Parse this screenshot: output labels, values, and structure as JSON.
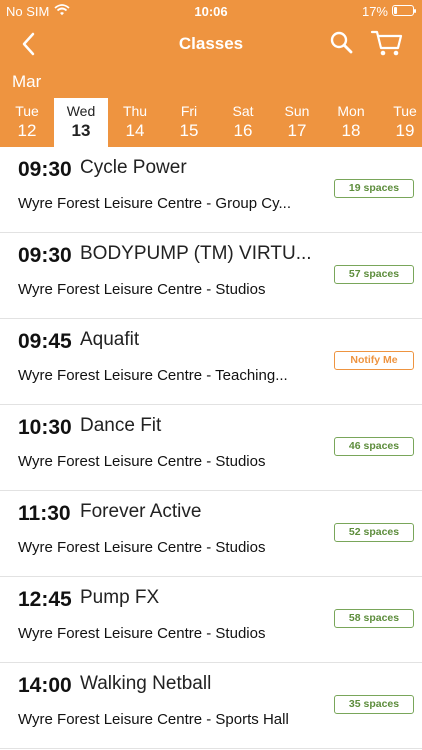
{
  "status_bar": {
    "carrier": "No SIM",
    "time": "10:06",
    "battery_percent": "17%",
    "battery_level": 0.17
  },
  "nav": {
    "title": "Classes",
    "back_icon": "chevron-left-icon",
    "search_icon": "search-icon",
    "cart_icon": "cart-icon"
  },
  "calendar": {
    "month": "Mar",
    "days": [
      {
        "name": "Tue",
        "num": "12",
        "selected": false
      },
      {
        "name": "Wed",
        "num": "13",
        "selected": true
      },
      {
        "name": "Thu",
        "num": "14",
        "selected": false
      },
      {
        "name": "Fri",
        "num": "15",
        "selected": false
      },
      {
        "name": "Sat",
        "num": "16",
        "selected": false
      },
      {
        "name": "Sun",
        "num": "17",
        "selected": false
      },
      {
        "name": "Mon",
        "num": "18",
        "selected": false
      },
      {
        "name": "Tue",
        "num": "19",
        "selected": false
      }
    ]
  },
  "classes": [
    {
      "time": "09:30",
      "name": "Cycle Power",
      "venue": "Wyre Forest Leisure Centre - Group Cy...",
      "badge": "19 spaces",
      "badge_type": "spaces"
    },
    {
      "time": "09:30",
      "name": "BODYPUMP (TM) VIRTU...",
      "venue": "Wyre Forest Leisure Centre - Studios",
      "badge": "57 spaces",
      "badge_type": "spaces"
    },
    {
      "time": "09:45",
      "name": "Aquafit",
      "venue": "Wyre Forest Leisure Centre - Teaching...",
      "badge": "Notify Me",
      "badge_type": "notify"
    },
    {
      "time": "10:30",
      "name": "Dance Fit",
      "venue": "Wyre Forest Leisure Centre - Studios",
      "badge": "46 spaces",
      "badge_type": "spaces"
    },
    {
      "time": "11:30",
      "name": "Forever Active",
      "venue": "Wyre Forest Leisure Centre - Studios",
      "badge": "52 spaces",
      "badge_type": "spaces"
    },
    {
      "time": "12:45",
      "name": "Pump FX",
      "venue": "Wyre Forest Leisure Centre - Studios",
      "badge": "58 spaces",
      "badge_type": "spaces"
    },
    {
      "time": "14:00",
      "name": "Walking Netball",
      "venue": "Wyre Forest Leisure Centre - Sports Hall",
      "badge": "35 spaces",
      "badge_type": "spaces"
    }
  ],
  "colors": {
    "brand_orange": "#ee9440",
    "spaces_green": "#79a65a",
    "notify_orange": "#ee9440"
  }
}
